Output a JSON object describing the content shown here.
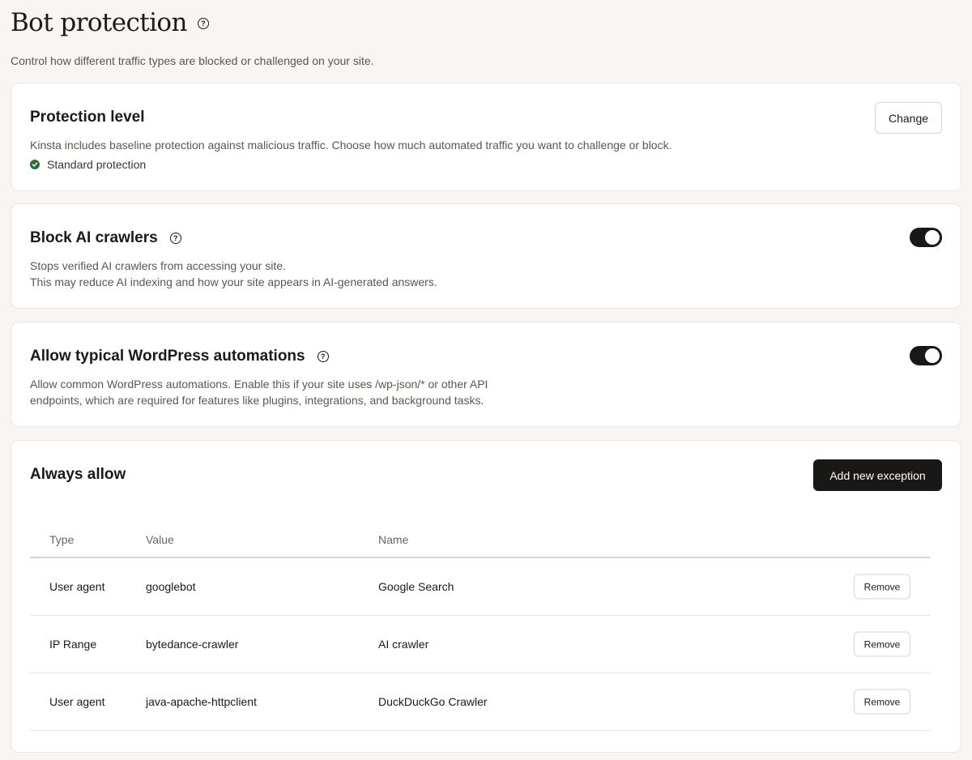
{
  "page": {
    "title": "Bot protection",
    "subtitle": "Control how different traffic types are blocked or challenged on your site."
  },
  "protection": {
    "title": "Protection level",
    "description": "Kinsta includes baseline protection against malicious traffic. Choose how much automated traffic you want to challenge or block.",
    "status": "Standard protection",
    "change_label": "Change"
  },
  "ai_crawlers": {
    "title": "Block AI crawlers",
    "description_line1": "Stops verified AI crawlers from accessing your site.",
    "description_line2": "This may reduce AI indexing and how your site appears in AI-generated answers.",
    "enabled": true
  },
  "wp_automations": {
    "title": "Allow typical WordPress automations",
    "description_line1": "Allow common WordPress automations. Enable this if your site uses /wp-json/* or other API",
    "description_line2": "endpoints, which are required for features like plugins, integrations, and background tasks.",
    "enabled": true
  },
  "always_allow": {
    "title": "Always allow",
    "add_label": "Add new exception",
    "columns": {
      "type": "Type",
      "value": "Value",
      "name": "Name"
    },
    "rows": [
      {
        "type": "User agent",
        "value": "googlebot",
        "name": "Google Search",
        "action": "Remove"
      },
      {
        "type": "IP Range",
        "value": "bytedance-crawler",
        "name": "AI crawler",
        "action": "Remove"
      },
      {
        "type": "User agent",
        "value": "java-apache-httpclient",
        "name": "DuckDuckGo Crawler",
        "action": "Remove"
      }
    ]
  },
  "icons": {
    "help": "help-circle-icon",
    "check": "check-circle-icon"
  },
  "colors": {
    "background": "#f8f5f2",
    "dark": "#1a1717",
    "success": "#2f6b3a",
    "muted_text": "#5c5650"
  }
}
